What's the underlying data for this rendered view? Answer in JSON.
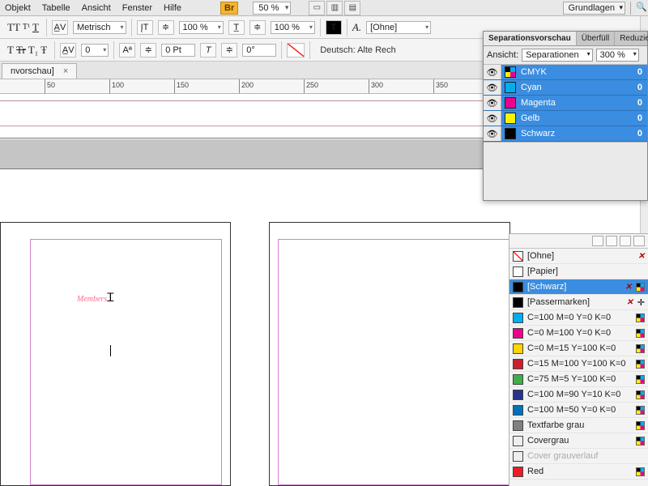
{
  "menu": {
    "objekt": "Objekt",
    "tabelle": "Tabelle",
    "ansicht": "Ansicht",
    "fenster": "Fenster",
    "hilfe": "Hilfe",
    "br": "Br",
    "zoom": "50 %",
    "workspace": "Grundlagen"
  },
  "toolbar": {
    "metrisch": "Metrisch",
    "pct1": "100 %",
    "pct2": "100 %",
    "pt": "0 Pt",
    "deg": "0°",
    "ohne": "[Ohne]",
    "lang": "Deutsch: Alte Rech"
  },
  "doc": {
    "tab": "nvorschau]",
    "members": "Members"
  },
  "ruler": {
    "marks": [
      "50",
      "100",
      "150",
      "200",
      "250",
      "300",
      "350"
    ]
  },
  "sep": {
    "tab1": "Separationsvorschau",
    "tab2": "Überfüll",
    "tab3": "Reduzie",
    "ansicht": "Ansicht:",
    "mode": "Separationen",
    "zoom": "300 %",
    "rows": [
      {
        "name": "CMYK",
        "color": "checker",
        "val": "0"
      },
      {
        "name": "Cyan",
        "color": "#00AEEF",
        "val": "0"
      },
      {
        "name": "Magenta",
        "color": "#EC008C",
        "val": "0"
      },
      {
        "name": "Gelb",
        "color": "#FFF200",
        "val": "0"
      },
      {
        "name": "Schwarz",
        "color": "#000000",
        "val": "0"
      }
    ]
  },
  "swatches": {
    "items": [
      {
        "label": "[Ohne]",
        "chip": "none",
        "x": true
      },
      {
        "label": "[Papier]",
        "chip": "#ffffff"
      },
      {
        "label": "[Schwarz]",
        "chip": "#000000",
        "sel": true,
        "x": true,
        "cmyk": true
      },
      {
        "label": "[Passermarken]",
        "chip": "#000000",
        "x": true,
        "reg": true
      },
      {
        "label": "C=100 M=0 Y=0 K=0",
        "chip": "#00AEEF",
        "cmyk": true
      },
      {
        "label": "C=0 M=100 Y=0 K=0",
        "chip": "#EC008C",
        "cmyk": true
      },
      {
        "label": "C=0 M=15 Y=100 K=0",
        "chip": "#FFD400",
        "cmyk": true
      },
      {
        "label": "C=15 M=100 Y=100 K=0",
        "chip": "#C8202F",
        "cmyk": true
      },
      {
        "label": "C=75 M=5 Y=100 K=0",
        "chip": "#3FAE49",
        "cmyk": true
      },
      {
        "label": "C=100 M=90 Y=10 K=0",
        "chip": "#27348B",
        "cmyk": true
      },
      {
        "label": "C=100 M=50 Y=0 K=0",
        "chip": "#0071BC",
        "cmyk": true
      },
      {
        "label": "Textfarbe grau",
        "chip": "#808080",
        "cmyk": true
      },
      {
        "label": "Covergrau",
        "chip": "#eeeeee",
        "cmyk": true
      },
      {
        "label": "Cover grauverlauf",
        "chip": "#eeeeee",
        "dis": true
      },
      {
        "label": "Red",
        "chip": "#ED1C24",
        "cmyk": true
      }
    ]
  }
}
